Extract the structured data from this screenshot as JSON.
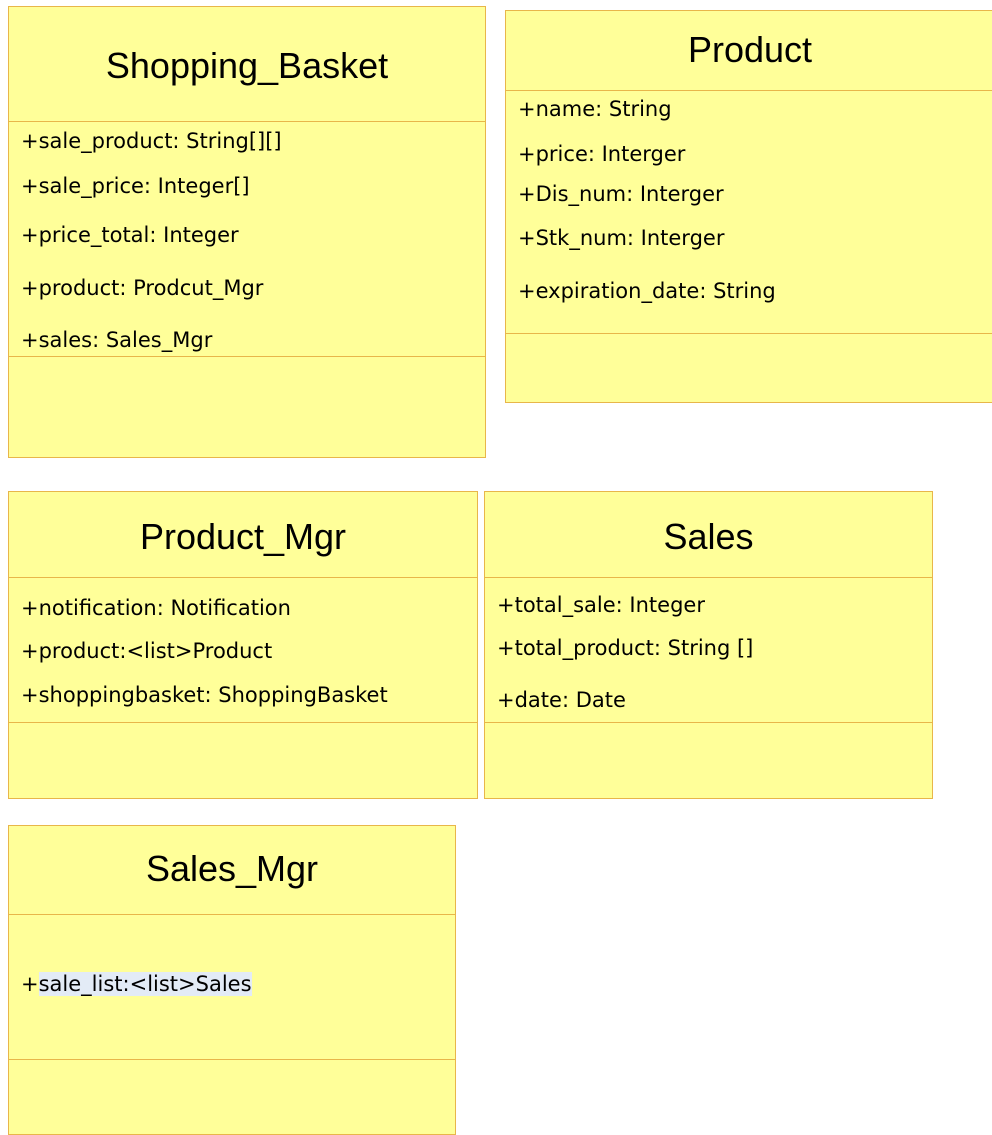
{
  "classes": {
    "shopping_basket": {
      "name": "Shopping_Basket",
      "attributes": [
        "+sale_product: String[][]",
        "+sale_price: Integer[]",
        "+price_total: Integer",
        "+product: Prodcut_Mgr",
        "+sales: Sales_Mgr"
      ]
    },
    "product": {
      "name": "Product",
      "attributes": [
        "+name: String",
        "+price: Interger",
        "+Dis_num: Interger",
        "+Stk_num: Interger",
        "+expiration_date: String"
      ]
    },
    "product_mgr": {
      "name": "Product_Mgr",
      "attributes": [
        "+notification: Notification",
        "+product:<list>Product",
        "+shoppingbasket: ShoppingBasket"
      ]
    },
    "sales": {
      "name": "Sales",
      "attributes": [
        "+total_sale: Integer",
        "+total_product: String []",
        "+date: Date"
      ]
    },
    "sales_mgr": {
      "name": "Sales_Mgr",
      "attributes_prefix": "+",
      "attributes_selected": "sale_list:<list>Sales"
    }
  },
  "colors": {
    "fill": "#ffff99",
    "border": "#e8b64a",
    "selection": "#e3ebf6"
  }
}
